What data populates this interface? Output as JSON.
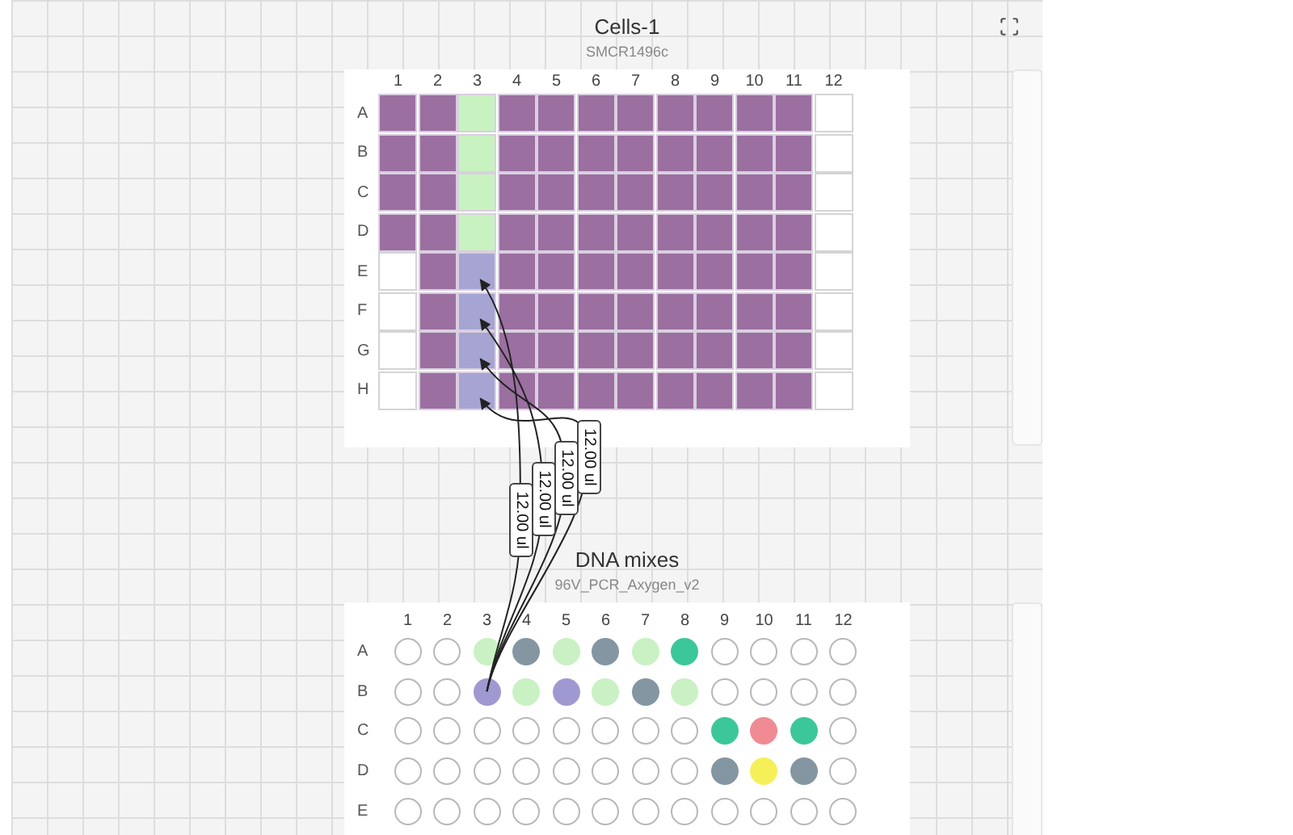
{
  "plates": [
    {
      "title": "Cells-1",
      "subtitle": "SMCR1496c",
      "kind": "square",
      "columns": [
        "1",
        "2",
        "3",
        "4",
        "5",
        "6",
        "7",
        "8",
        "9",
        "10",
        "11",
        "12"
      ],
      "rows": [
        {
          "label": "A",
          "wells": [
            {
              "filled": true,
              "color": "#9b6fa0"
            },
            {
              "filled": true,
              "color": "#9b6fa0"
            },
            {
              "filled": true,
              "color": "#c8f2c0"
            },
            {
              "filled": true,
              "color": "#9b6fa0"
            },
            {
              "filled": true,
              "color": "#9b6fa0"
            },
            {
              "filled": true,
              "color": "#9b6fa0"
            },
            {
              "filled": true,
              "color": "#9b6fa0"
            },
            {
              "filled": true,
              "color": "#9b6fa0"
            },
            {
              "filled": true,
              "color": "#9b6fa0"
            },
            {
              "filled": true,
              "color": "#9b6fa0"
            },
            {
              "filled": true,
              "color": "#9b6fa0"
            },
            {
              "filled": false
            }
          ]
        },
        {
          "label": "B",
          "wells": [
            {
              "filled": true,
              "color": "#9b6fa0"
            },
            {
              "filled": true,
              "color": "#9b6fa0"
            },
            {
              "filled": true,
              "color": "#c8f2c0"
            },
            {
              "filled": true,
              "color": "#9b6fa0"
            },
            {
              "filled": true,
              "color": "#9b6fa0"
            },
            {
              "filled": true,
              "color": "#9b6fa0"
            },
            {
              "filled": true,
              "color": "#9b6fa0"
            },
            {
              "filled": true,
              "color": "#9b6fa0"
            },
            {
              "filled": true,
              "color": "#9b6fa0"
            },
            {
              "filled": true,
              "color": "#9b6fa0"
            },
            {
              "filled": true,
              "color": "#9b6fa0"
            },
            {
              "filled": false
            }
          ]
        },
        {
          "label": "C",
          "wells": [
            {
              "filled": true,
              "color": "#9b6fa0"
            },
            {
              "filled": true,
              "color": "#9b6fa0"
            },
            {
              "filled": true,
              "color": "#c8f2c0"
            },
            {
              "filled": true,
              "color": "#9b6fa0"
            },
            {
              "filled": true,
              "color": "#9b6fa0"
            },
            {
              "filled": true,
              "color": "#9b6fa0"
            },
            {
              "filled": true,
              "color": "#9b6fa0"
            },
            {
              "filled": true,
              "color": "#9b6fa0"
            },
            {
              "filled": true,
              "color": "#9b6fa0"
            },
            {
              "filled": true,
              "color": "#9b6fa0"
            },
            {
              "filled": true,
              "color": "#9b6fa0"
            },
            {
              "filled": false
            }
          ]
        },
        {
          "label": "D",
          "wells": [
            {
              "filled": true,
              "color": "#9b6fa0"
            },
            {
              "filled": true,
              "color": "#9b6fa0"
            },
            {
              "filled": true,
              "color": "#c8f2c0"
            },
            {
              "filled": true,
              "color": "#9b6fa0"
            },
            {
              "filled": true,
              "color": "#9b6fa0"
            },
            {
              "filled": true,
              "color": "#9b6fa0"
            },
            {
              "filled": true,
              "color": "#9b6fa0"
            },
            {
              "filled": true,
              "color": "#9b6fa0"
            },
            {
              "filled": true,
              "color": "#9b6fa0"
            },
            {
              "filled": true,
              "color": "#9b6fa0"
            },
            {
              "filled": true,
              "color": "#9b6fa0"
            },
            {
              "filled": false
            }
          ]
        },
        {
          "label": "E",
          "wells": [
            {
              "filled": false
            },
            {
              "filled": true,
              "color": "#9b6fa0"
            },
            {
              "filled": true,
              "color": "#a6a4d2"
            },
            {
              "filled": true,
              "color": "#9b6fa0"
            },
            {
              "filled": true,
              "color": "#9b6fa0"
            },
            {
              "filled": true,
              "color": "#9b6fa0"
            },
            {
              "filled": true,
              "color": "#9b6fa0"
            },
            {
              "filled": true,
              "color": "#9b6fa0"
            },
            {
              "filled": true,
              "color": "#9b6fa0"
            },
            {
              "filled": true,
              "color": "#9b6fa0"
            },
            {
              "filled": true,
              "color": "#9b6fa0"
            },
            {
              "filled": false
            }
          ]
        },
        {
          "label": "F",
          "wells": [
            {
              "filled": false
            },
            {
              "filled": true,
              "color": "#9b6fa0"
            },
            {
              "filled": true,
              "color": "#a6a4d2"
            },
            {
              "filled": true,
              "color": "#9b6fa0"
            },
            {
              "filled": true,
              "color": "#9b6fa0"
            },
            {
              "filled": true,
              "color": "#9b6fa0"
            },
            {
              "filled": true,
              "color": "#9b6fa0"
            },
            {
              "filled": true,
              "color": "#9b6fa0"
            },
            {
              "filled": true,
              "color": "#9b6fa0"
            },
            {
              "filled": true,
              "color": "#9b6fa0"
            },
            {
              "filled": true,
              "color": "#9b6fa0"
            },
            {
              "filled": false
            }
          ]
        },
        {
          "label": "G",
          "wells": [
            {
              "filled": false
            },
            {
              "filled": true,
              "color": "#9b6fa0"
            },
            {
              "filled": true,
              "color": "#a6a4d2"
            },
            {
              "filled": true,
              "color": "#9b6fa0"
            },
            {
              "filled": true,
              "color": "#9b6fa0"
            },
            {
              "filled": true,
              "color": "#9b6fa0"
            },
            {
              "filled": true,
              "color": "#9b6fa0"
            },
            {
              "filled": true,
              "color": "#9b6fa0"
            },
            {
              "filled": true,
              "color": "#9b6fa0"
            },
            {
              "filled": true,
              "color": "#9b6fa0"
            },
            {
              "filled": true,
              "color": "#9b6fa0"
            },
            {
              "filled": false
            }
          ]
        },
        {
          "label": "H",
          "wells": [
            {
              "filled": false
            },
            {
              "filled": true,
              "color": "#9b6fa0"
            },
            {
              "filled": true,
              "color": "#a6a4d2"
            },
            {
              "filled": true,
              "color": "#9b6fa0"
            },
            {
              "filled": true,
              "color": "#9b6fa0"
            },
            {
              "filled": true,
              "color": "#9b6fa0"
            },
            {
              "filled": true,
              "color": "#9b6fa0"
            },
            {
              "filled": true,
              "color": "#9b6fa0"
            },
            {
              "filled": true,
              "color": "#9b6fa0"
            },
            {
              "filled": true,
              "color": "#9b6fa0"
            },
            {
              "filled": true,
              "color": "#9b6fa0"
            },
            {
              "filled": false
            }
          ]
        }
      ]
    },
    {
      "title": "DNA mixes",
      "subtitle": "96V_PCR_Axygen_v2",
      "kind": "round",
      "columns": [
        "1",
        "2",
        "3",
        "4",
        "5",
        "6",
        "7",
        "8",
        "9",
        "10",
        "11",
        "12"
      ],
      "rows": [
        {
          "label": "A",
          "wells": [
            {
              "filled": false
            },
            {
              "filled": false
            },
            {
              "filled": true,
              "color": "#c9f1c3"
            },
            {
              "filled": true,
              "color": "#8496a2"
            },
            {
              "filled": true,
              "color": "#c9f1c3"
            },
            {
              "filled": true,
              "color": "#8496a2"
            },
            {
              "filled": true,
              "color": "#c9f1c3"
            },
            {
              "filled": true,
              "color": "#3cc79a"
            },
            {
              "filled": false
            },
            {
              "filled": false
            },
            {
              "filled": false
            },
            {
              "filled": false
            }
          ]
        },
        {
          "label": "B",
          "wells": [
            {
              "filled": false
            },
            {
              "filled": false
            },
            {
              "filled": true,
              "color": "#9f99d1"
            },
            {
              "filled": true,
              "color": "#c9f1c3"
            },
            {
              "filled": true,
              "color": "#9f99d1"
            },
            {
              "filled": true,
              "color": "#c9f1c3"
            },
            {
              "filled": true,
              "color": "#8496a2"
            },
            {
              "filled": true,
              "color": "#c9f1c3"
            },
            {
              "filled": false
            },
            {
              "filled": false
            },
            {
              "filled": false
            },
            {
              "filled": false
            }
          ]
        },
        {
          "label": "C",
          "wells": [
            {
              "filled": false
            },
            {
              "filled": false
            },
            {
              "filled": false
            },
            {
              "filled": false
            },
            {
              "filled": false
            },
            {
              "filled": false
            },
            {
              "filled": false
            },
            {
              "filled": false
            },
            {
              "filled": true,
              "color": "#3cc79a"
            },
            {
              "filled": true,
              "color": "#f08b94"
            },
            {
              "filled": true,
              "color": "#3cc79a"
            },
            {
              "filled": false
            }
          ]
        },
        {
          "label": "D",
          "wells": [
            {
              "filled": false
            },
            {
              "filled": false
            },
            {
              "filled": false
            },
            {
              "filled": false
            },
            {
              "filled": false
            },
            {
              "filled": false
            },
            {
              "filled": false
            },
            {
              "filled": false
            },
            {
              "filled": true,
              "color": "#8496a2"
            },
            {
              "filled": true,
              "color": "#f5f05a"
            },
            {
              "filled": true,
              "color": "#8496a2"
            },
            {
              "filled": false
            }
          ]
        },
        {
          "label": "E",
          "wells": [
            {
              "filled": false
            },
            {
              "filled": false
            },
            {
              "filled": false
            },
            {
              "filled": false
            },
            {
              "filled": false
            },
            {
              "filled": false
            },
            {
              "filled": false
            },
            {
              "filled": false
            },
            {
              "filled": false
            },
            {
              "filled": false
            },
            {
              "filled": false
            },
            {
              "filled": false
            }
          ]
        }
      ]
    }
  ],
  "transfers": [
    {
      "volume": "12.00 ul"
    },
    {
      "volume": "12.00 ul"
    },
    {
      "volume": "12.00 ul"
    },
    {
      "volume": "12.00 ul"
    }
  ]
}
